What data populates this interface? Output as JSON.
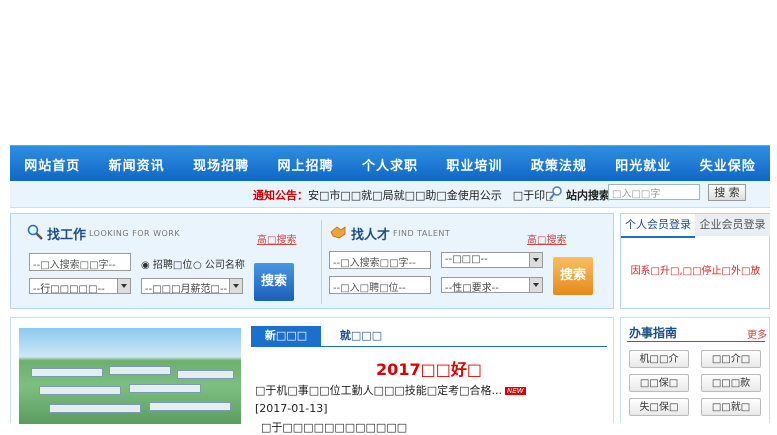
{
  "nav": [
    "网站首页",
    "新闻资讯",
    "现场招聘",
    "网上招聘",
    "个人求职",
    "职业培训",
    "政策法规",
    "阳光就业",
    "失业保险"
  ],
  "notice": {
    "label": "通知公告：",
    "text": "安□市□□就□局就□□助□金使用公示　□于印□安□市□取失□□",
    "site_search_label": "站内搜索：",
    "site_search_placeholder": "□入□□字",
    "site_search_button": "搜 索"
  },
  "find_work": {
    "title": "找工作",
    "subtitle": "LOOKING FOR WORK",
    "advanced": "高□搜索",
    "keyword_placeholder": "--□入搜索□□字--",
    "radio1": "招聘□位",
    "radio2": "公司名称",
    "industry_select": "--行□□□□□--",
    "salary_select": "--□□□月薪范□--",
    "button": "搜索"
  },
  "find_talent": {
    "title": "找人才",
    "subtitle": "FIND TALENT",
    "advanced": "高□搜索",
    "keyword_placeholder": "--□入搜索□□字--",
    "select1": "--□□□--",
    "position_placeholder": "--□入□聘□位--",
    "gender_select": "--性□要求--",
    "button": "搜索"
  },
  "login": {
    "tab_personal": "个人会员登录",
    "tab_company": "企业会员登录",
    "message": "因系□升□,□□停止□外□放"
  },
  "news": {
    "tab_news": "新□□□",
    "tab_jobs": "就□□□",
    "headline": "2017□□好□",
    "item1": "□于机□事□□位工勤人□□□技能□定考□合格...",
    "item1_badge": "NEW",
    "item1_date": "[2017-01-13]",
    "item2": "□于□□□□□□□□□□□□"
  },
  "guide": {
    "title": "办事指南",
    "more": "更多",
    "buttons": [
      "机□□介",
      "□□介□",
      "□□保□",
      "□□□款",
      "失□保□",
      "□□就□"
    ]
  },
  "colors": {
    "nav_bg": "#0e66c6",
    "accent_red": "#cc0000",
    "panel_bg": "#eaf4fc",
    "work_button": "#1a6fcf",
    "talent_button": "#f0a030"
  }
}
